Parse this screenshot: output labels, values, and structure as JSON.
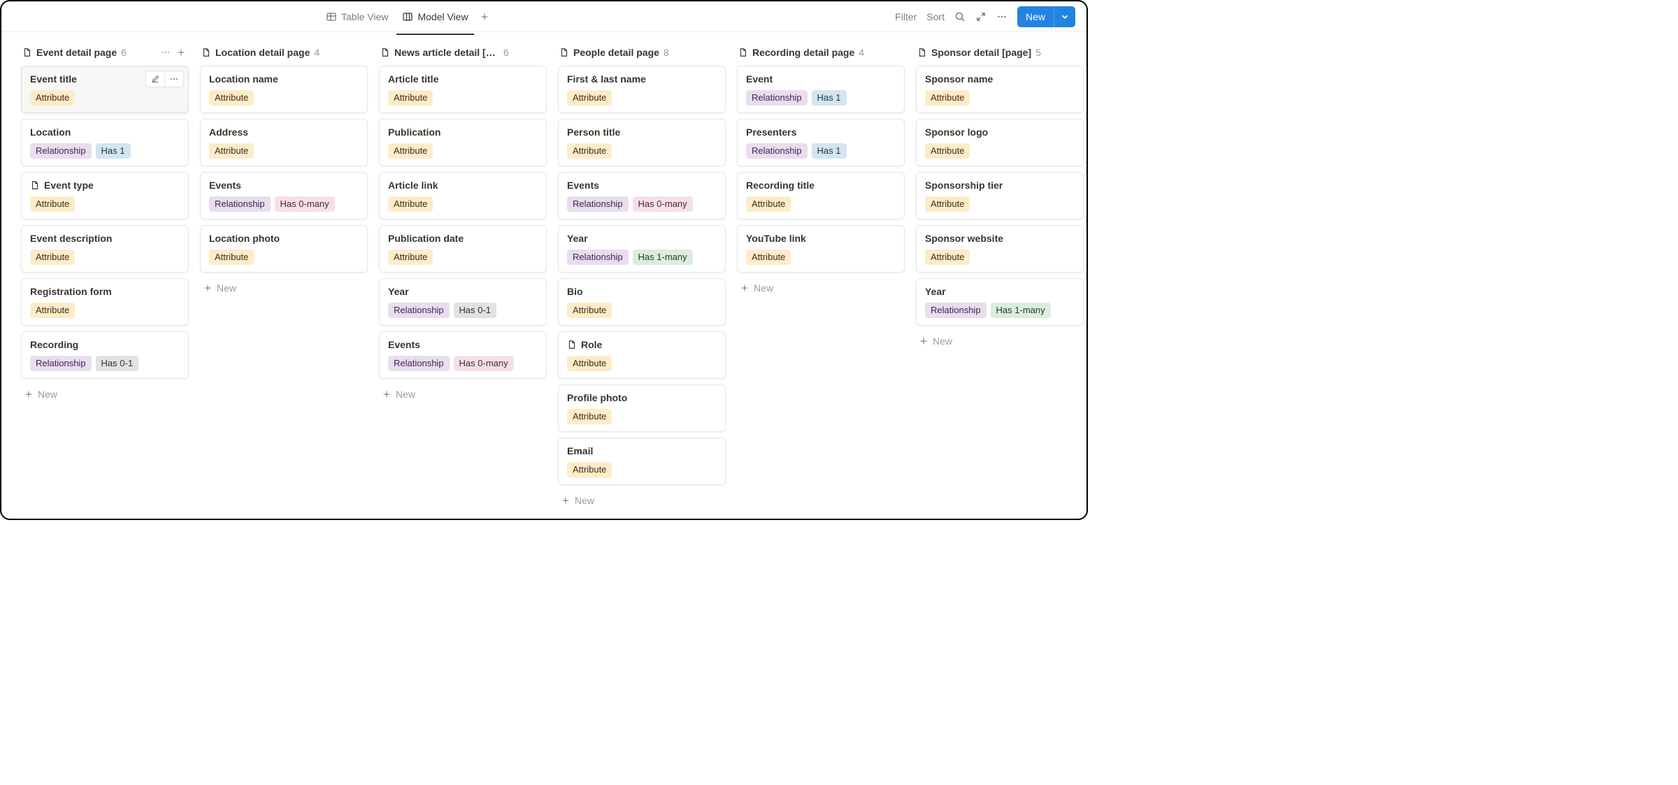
{
  "toolbar": {
    "table_view_label": "Table View",
    "model_view_label": "Model View",
    "filter_label": "Filter",
    "sort_label": "Sort",
    "new_label": "New"
  },
  "new_label": "New",
  "tag_labels": {
    "attribute": "Attribute",
    "relationship": "Relationship",
    "has1": "Has 1",
    "has0many": "Has 0-many",
    "has1many": "Has 1-many",
    "has01": "Has 0-1"
  },
  "columns": [
    {
      "title": "Event detail page",
      "count": "6",
      "show_header_actions": true,
      "cards": [
        {
          "title": "Event title",
          "hovered": true,
          "tags": [
            "attribute"
          ]
        },
        {
          "title": "Location",
          "tags": [
            "relationship",
            "has1"
          ]
        },
        {
          "title": "Event type",
          "icon": true,
          "tags": [
            "attribute"
          ]
        },
        {
          "title": "Event description",
          "tags": [
            "attribute"
          ]
        },
        {
          "title": "Registration form",
          "tags": [
            "attribute"
          ]
        },
        {
          "title": "Recording",
          "tags": [
            "relationship",
            "has01"
          ]
        }
      ]
    },
    {
      "title": "Location detail page",
      "count": "4",
      "cards": [
        {
          "title": "Location name",
          "tags": [
            "attribute"
          ]
        },
        {
          "title": "Address",
          "tags": [
            "attribute"
          ]
        },
        {
          "title": "Events",
          "tags": [
            "relationship",
            "has0many"
          ]
        },
        {
          "title": "Location photo",
          "tags": [
            "attribute"
          ]
        }
      ]
    },
    {
      "title": "News article detail [p…",
      "count": "6",
      "cards": [
        {
          "title": "Article title",
          "tags": [
            "attribute"
          ]
        },
        {
          "title": "Publication",
          "tags": [
            "attribute"
          ]
        },
        {
          "title": "Article link",
          "tags": [
            "attribute"
          ]
        },
        {
          "title": "Publication date",
          "tags": [
            "attribute"
          ]
        },
        {
          "title": "Year",
          "tags": [
            "relationship",
            "has01"
          ]
        },
        {
          "title": "Events",
          "tags": [
            "relationship",
            "has0many"
          ]
        }
      ]
    },
    {
      "title": "People detail page",
      "count": "8",
      "cards": [
        {
          "title": "First & last name",
          "tags": [
            "attribute"
          ]
        },
        {
          "title": "Person title",
          "tags": [
            "attribute"
          ]
        },
        {
          "title": "Events",
          "tags": [
            "relationship",
            "has0many"
          ]
        },
        {
          "title": "Year",
          "tags": [
            "relationship",
            "has1many"
          ]
        },
        {
          "title": "Bio",
          "tags": [
            "attribute"
          ]
        },
        {
          "title": "Role",
          "icon": true,
          "tags": [
            "attribute"
          ]
        },
        {
          "title": "Profile photo",
          "tags": [
            "attribute"
          ]
        },
        {
          "title": "Email",
          "tags": [
            "attribute"
          ]
        }
      ]
    },
    {
      "title": "Recording detail page",
      "count": "4",
      "cards": [
        {
          "title": "Event",
          "tags": [
            "relationship",
            "has1"
          ]
        },
        {
          "title": "Presenters",
          "tags": [
            "relationship",
            "has1"
          ]
        },
        {
          "title": "Recording title",
          "tags": [
            "attribute"
          ]
        },
        {
          "title": "YouTube link",
          "tags": [
            "attribute"
          ]
        }
      ]
    },
    {
      "title": "Sponsor detail [page]",
      "count": "5",
      "cards": [
        {
          "title": "Sponsor name",
          "tags": [
            "attribute"
          ]
        },
        {
          "title": "Sponsor logo",
          "tags": [
            "attribute"
          ]
        },
        {
          "title": "Sponsorship tier",
          "tags": [
            "attribute"
          ]
        },
        {
          "title": "Sponsor website",
          "tags": [
            "attribute"
          ]
        },
        {
          "title": "Year",
          "tags": [
            "relationship",
            "has1many"
          ]
        }
      ]
    }
  ]
}
